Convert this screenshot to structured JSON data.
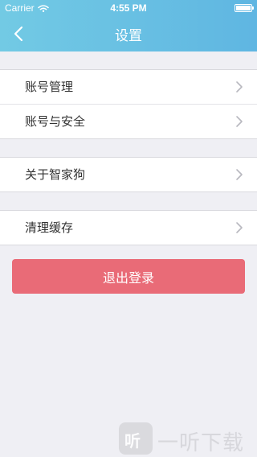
{
  "status_bar": {
    "carrier": "Carrier",
    "time": "4:55 PM"
  },
  "nav": {
    "title": "设置"
  },
  "settings": {
    "group1": [
      {
        "label": "账号管理"
      },
      {
        "label": "账号与安全"
      }
    ],
    "group2": [
      {
        "label": "关于智家狗"
      }
    ],
    "group3": [
      {
        "label": "清理缓存"
      }
    ]
  },
  "logout": {
    "label": "退出登录"
  },
  "watermark": {
    "logo_text": "听",
    "text": "一听下载"
  }
}
